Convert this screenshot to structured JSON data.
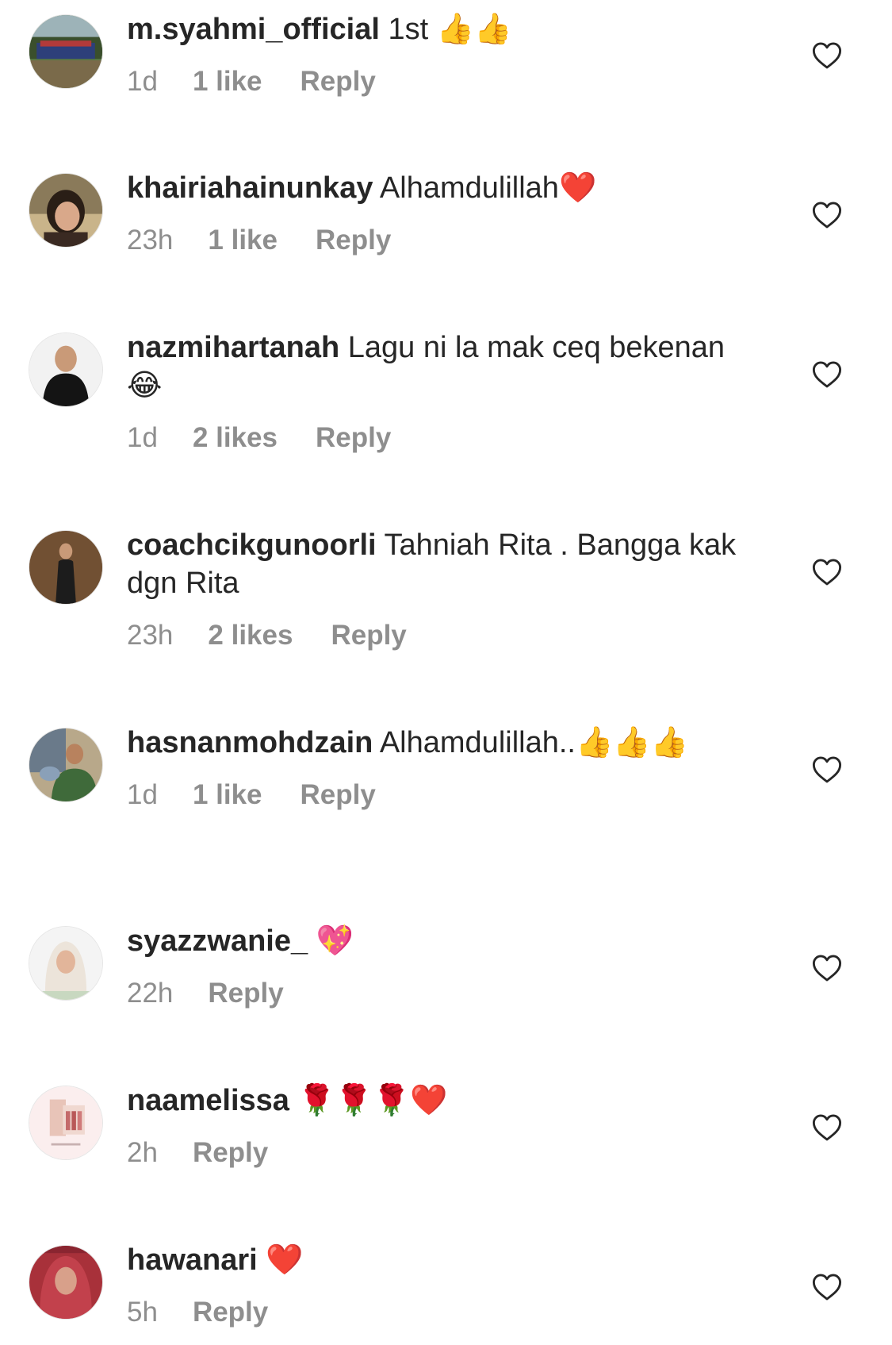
{
  "comments": [
    {
      "username": "m.syahmi_official",
      "text": " 1st 👍👍",
      "time": "1d",
      "likes": "1 like",
      "reply": "Reply",
      "avatar": "group-photo-field"
    },
    {
      "username": "khairiahainunkay",
      "text": " Alhamdulillah❤️",
      "time": "23h",
      "likes": "1 like",
      "reply": "Reply",
      "avatar": "woman-portrait"
    },
    {
      "username": "nazmihartanah",
      "text": " Lagu ni la mak ceq bekenan 😂",
      "time": "1d",
      "likes": "2 likes",
      "reply": "Reply",
      "avatar": "man-dark-suit"
    },
    {
      "username": "coachcikgunoorli",
      "text": " Tahniah Rita . Bangga kak dgn Rita",
      "time": "23h",
      "likes": "2 likes",
      "reply": "Reply",
      "avatar": "woman-standing"
    },
    {
      "username": "hasnanmohdzain",
      "text": " Alhamdulillah..👍👍👍",
      "time": "1d",
      "likes": "1 like",
      "reply": "Reply",
      "avatar": "man-green-shirt"
    },
    {
      "username": "syazzwanie_",
      "text": " 💖",
      "time": "22h",
      "likes": "",
      "reply": "Reply",
      "avatar": "woman-hijab-white"
    },
    {
      "username": "naamelissa",
      "text": " 🌹🌹🌹❤️",
      "time": "2h",
      "likes": "",
      "reply": "Reply",
      "avatar": "product-photo-pink"
    },
    {
      "username": "hawanari",
      "text": " ❤️",
      "time": "5h",
      "likes": "",
      "reply": "Reply",
      "avatar": "woman-hijab-red"
    }
  ],
  "colors": {
    "text_primary": "#262626",
    "text_secondary": "#8e8e8e",
    "icon": "#262626",
    "background": "#ffffff"
  },
  "icons": {
    "like": "heart-outline-icon"
  }
}
